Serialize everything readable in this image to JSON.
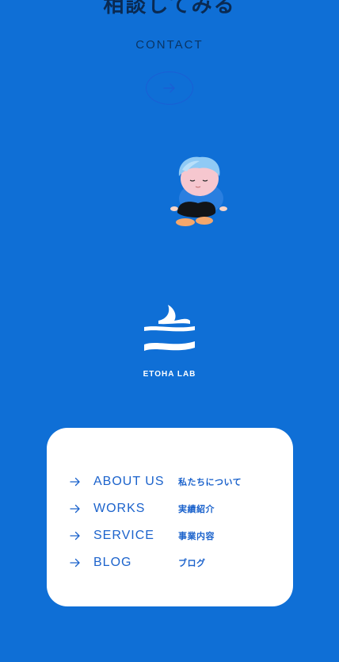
{
  "page": {
    "heading_partial": "相談してみる",
    "contact_label": "CONTACT"
  },
  "logo": {
    "text": "ETOHA LAB"
  },
  "menu": {
    "items": [
      {
        "en": "ABOUT US",
        "ja": "私たちについて"
      },
      {
        "en": "WORKS",
        "ja": "実績紹介"
      },
      {
        "en": "SERVICE",
        "ja": "事業内容"
      },
      {
        "en": "BLOG",
        "ja": "ブログ"
      }
    ]
  },
  "icons": {
    "contact": "arrow-right-icon",
    "menu": "arrow-right-icon",
    "illustration": "sitting-character-illustration",
    "brand": "etoha-lab-logo"
  },
  "colors": {
    "background": "#0f6fd6",
    "card": "#ffffff",
    "accent": "#1c63cc",
    "text_dark": "#0a3565"
  }
}
